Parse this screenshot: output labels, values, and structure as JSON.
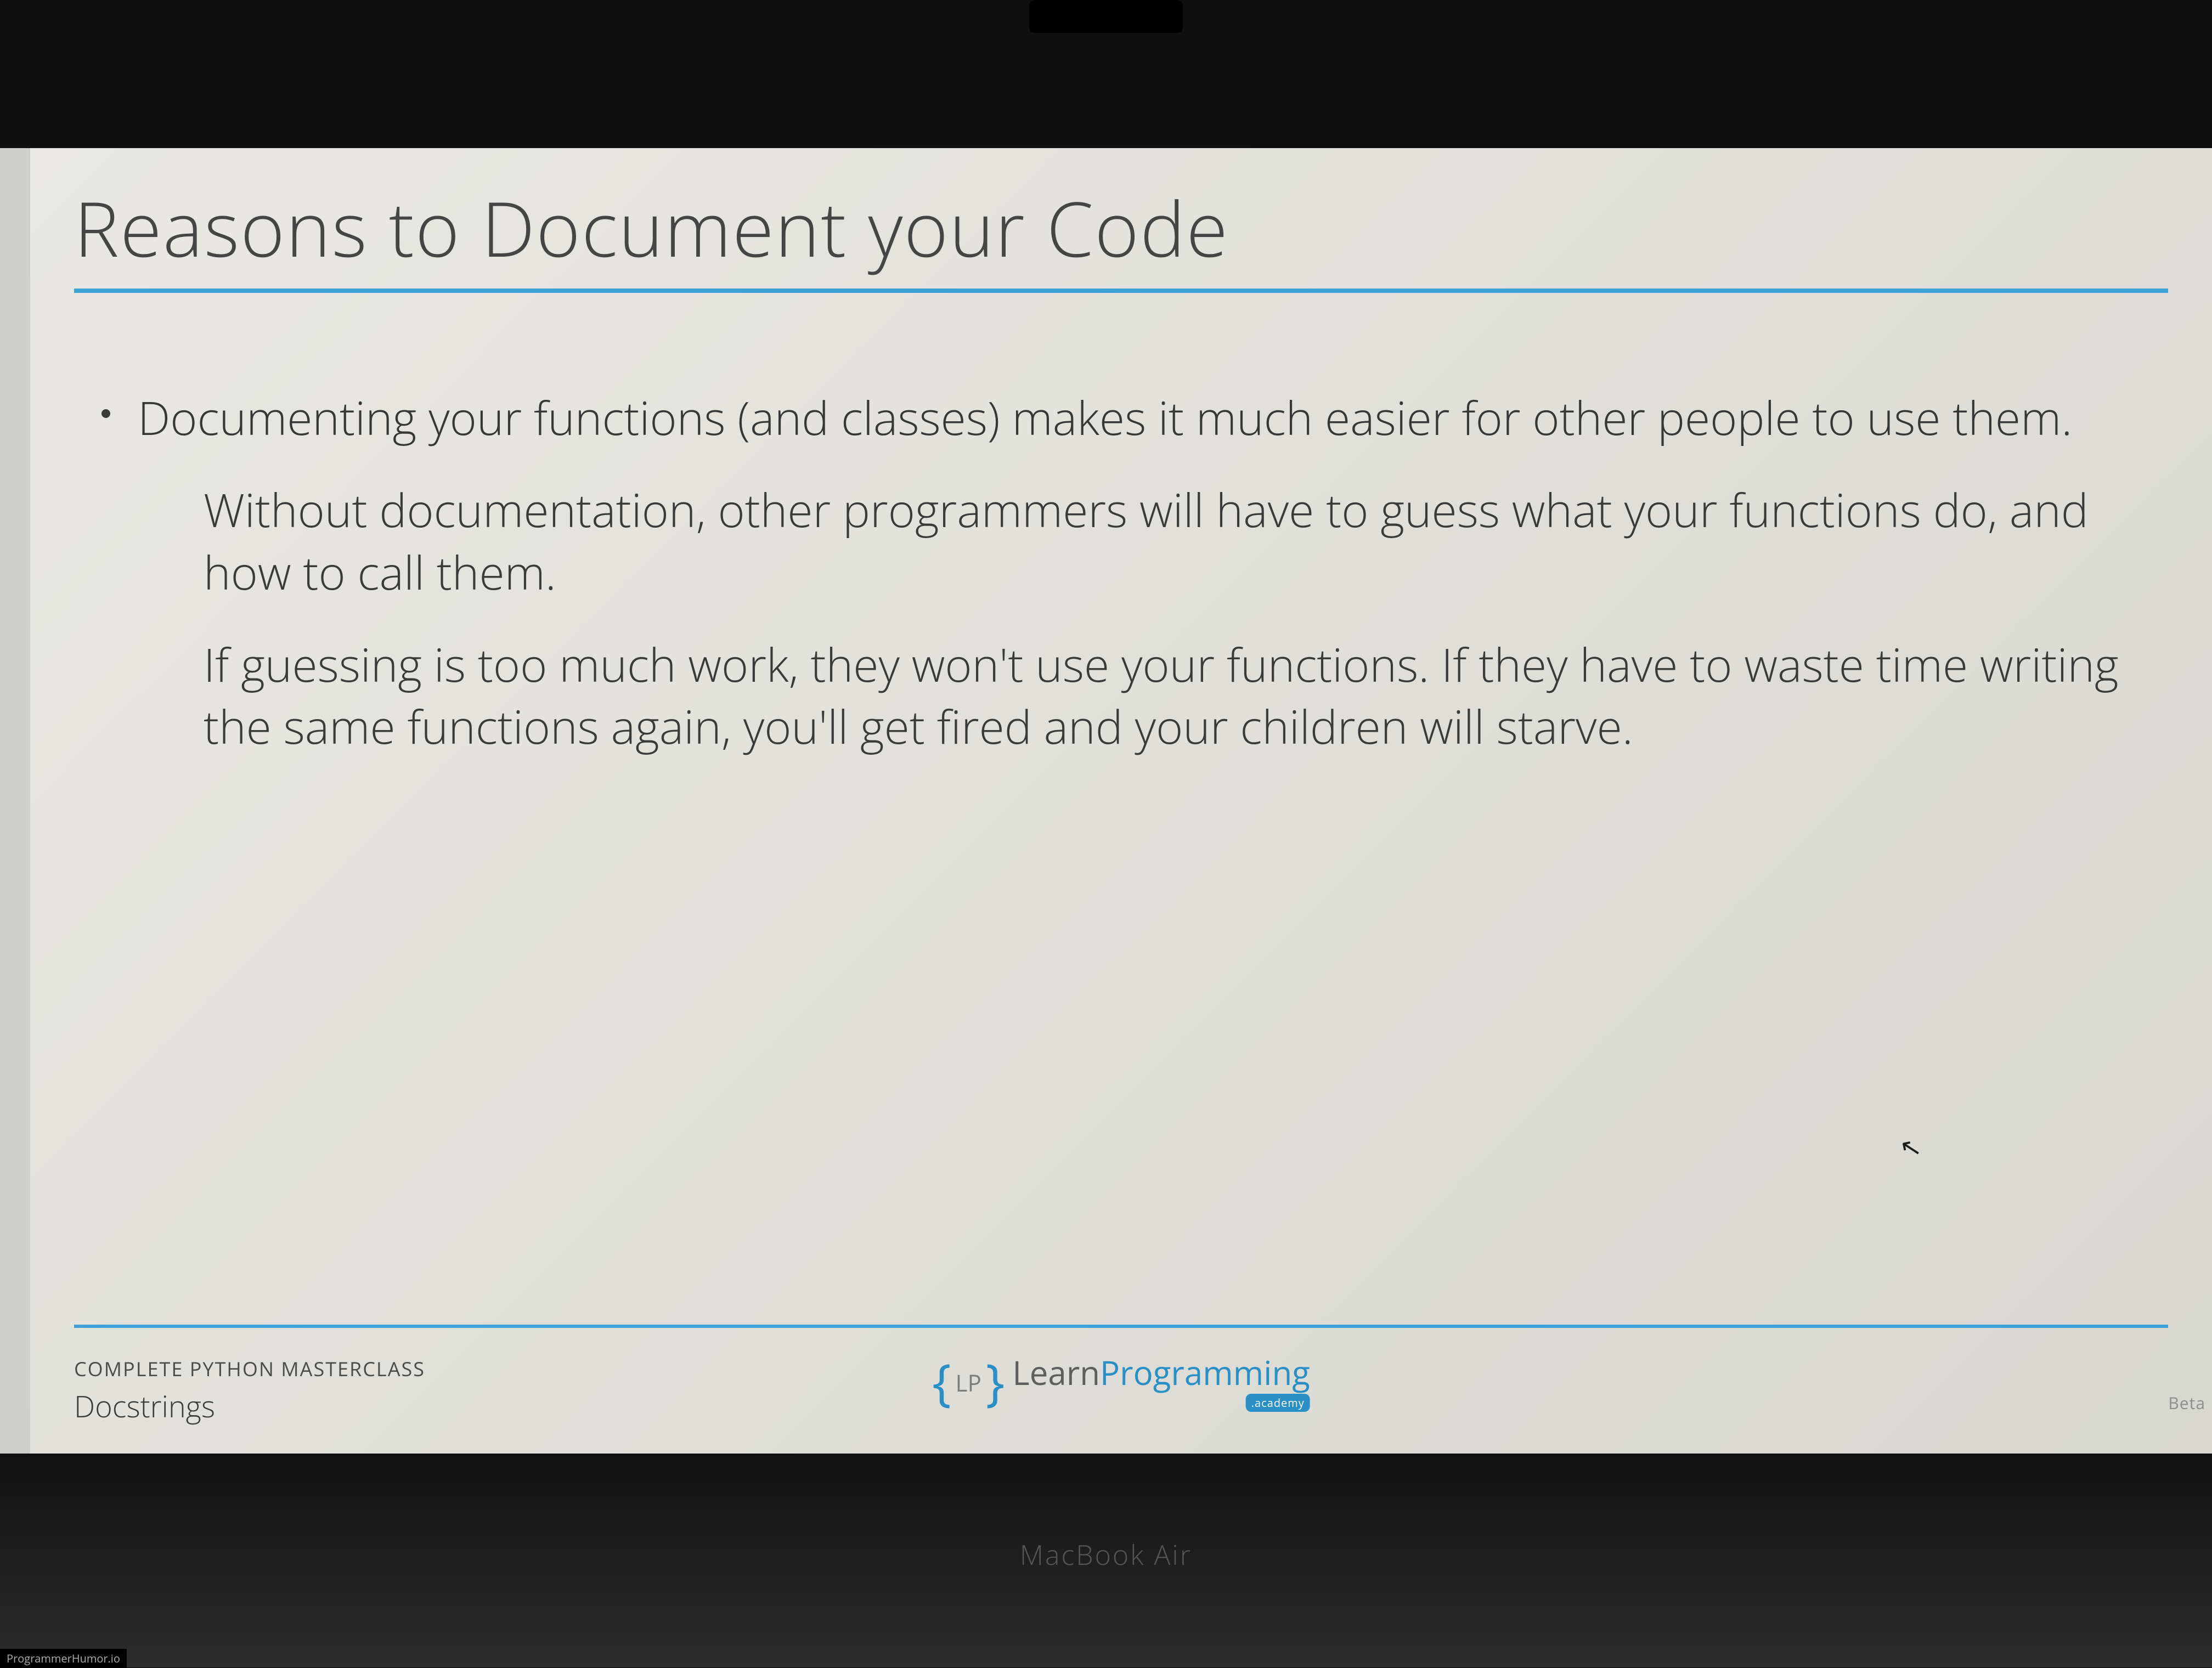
{
  "slide": {
    "title": "Reasons to Document your Code",
    "bullet_main": "Documenting your functions (and classes) makes it much easier for other people to use them.",
    "sub_1": "Without documentation, other programmers will have to guess what your functions do, and how to call them.",
    "sub_2": "If guessing is too much work, they won't use your functions. If they have to waste time writing the same functions again, you'll get fired and your children will starve."
  },
  "footer": {
    "course": "COMPLETE PYTHON MASTERCLASS",
    "lesson": "Docstrings",
    "logo_lp": "LP",
    "logo_learn": "Learn",
    "logo_prog": "Programming",
    "logo_badge": ".academy"
  },
  "laptop": {
    "model": "MacBook Air"
  },
  "watermark": "ProgrammerHumor.io",
  "beta": "Beta",
  "colors": {
    "accent": "#3fa2d6",
    "text_dark": "#373737"
  }
}
